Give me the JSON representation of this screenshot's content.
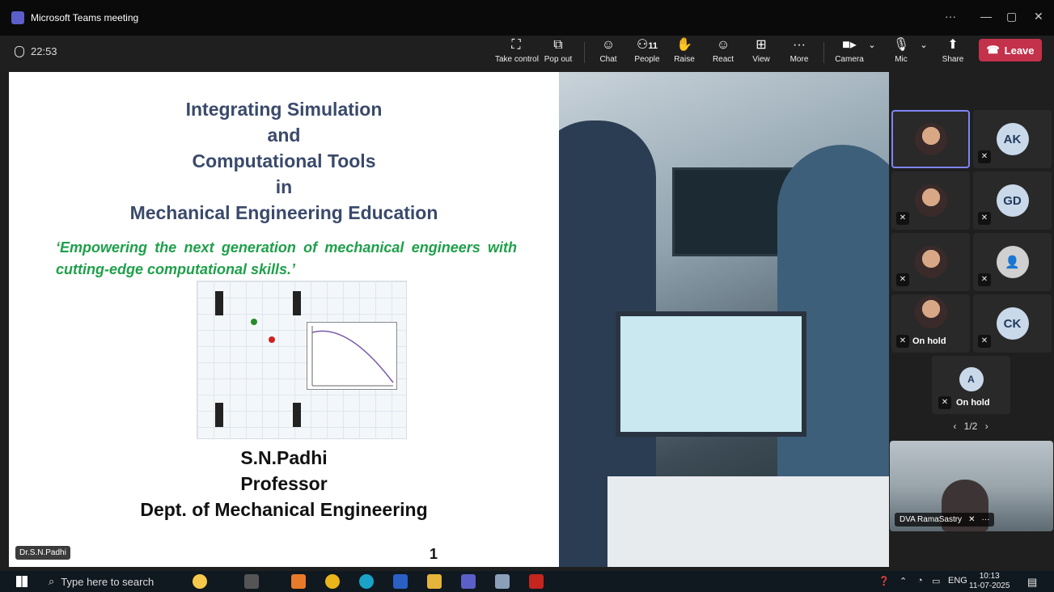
{
  "window": {
    "title": "Microsoft Teams meeting"
  },
  "meeting": {
    "timer": "22:53"
  },
  "toolbar": {
    "take_control": "Take control",
    "pop_out": "Pop out",
    "chat": "Chat",
    "people": "People",
    "people_count": "11",
    "raise": "Raise",
    "react": "React",
    "view": "View",
    "more": "More",
    "camera": "Camera",
    "mic": "Mic",
    "share": "Share",
    "leave": "Leave"
  },
  "slide": {
    "title_lines": [
      "Integrating Simulation",
      "and",
      "Computational Tools",
      "in",
      "Mechanical Engineering Education"
    ],
    "tagline": "‘Empowering the next generation of mechanical engineers with cutting-edge computational skills.’",
    "author": "S.N.Padhi",
    "role": "Professor",
    "dept": "Dept. of Mechanical Engineering",
    "number": "1",
    "presenter_tag": "Dr.S.N.Padhi"
  },
  "participants": [
    {
      "initials": "",
      "type": "photo",
      "muted": false,
      "active": true
    },
    {
      "initials": "AK",
      "type": "initials",
      "muted": true
    },
    {
      "initials": "",
      "type": "photo",
      "muted": true
    },
    {
      "initials": "GD",
      "type": "initials",
      "muted": true
    },
    {
      "initials": "",
      "type": "photo",
      "muted": true
    },
    {
      "initials": "",
      "type": "generic",
      "muted": true
    },
    {
      "initials": "",
      "type": "photo",
      "muted": true,
      "status": "On hold"
    },
    {
      "initials": "CK",
      "type": "initials",
      "muted": true
    },
    {
      "initials": "A",
      "type": "initials",
      "muted": true,
      "status": "On hold"
    }
  ],
  "pager": "1/2",
  "self_view": {
    "name": "DVA RamaSastry"
  },
  "taskbar": {
    "search_placeholder": "Type here to search",
    "language": "ENG",
    "time": "10:13",
    "date": "11-07-2025"
  }
}
